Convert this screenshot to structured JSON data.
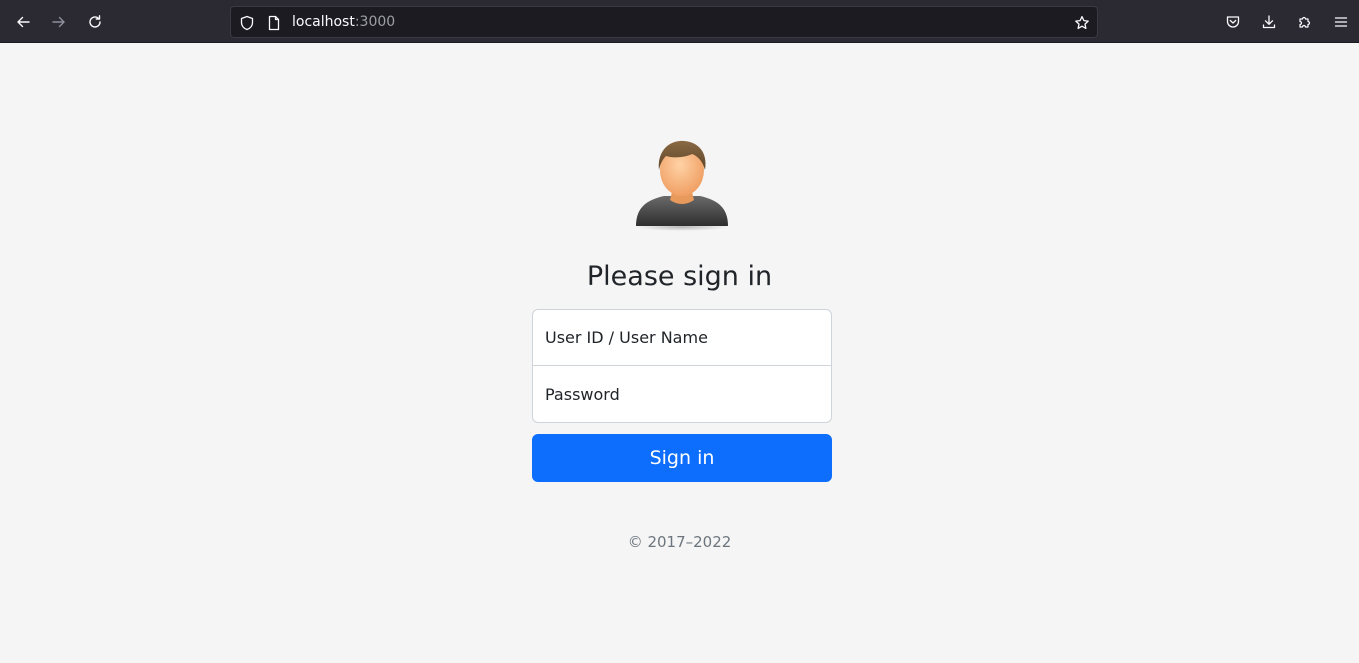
{
  "browser": {
    "url_host": "localhost",
    "url_port": ":3000",
    "icons": {
      "back": "arrow-left-icon",
      "forward": "arrow-right-icon",
      "reload": "reload-icon",
      "shield": "shield-icon",
      "page": "page-icon",
      "bookmark": "star-icon",
      "pocket": "pocket-icon",
      "downloads": "download-icon",
      "extensions": "puzzle-icon",
      "menu": "hamburger-menu-icon"
    }
  },
  "login": {
    "avatar_icon": "user-avatar-icon",
    "title": "Please sign in",
    "username_placeholder": "User ID / User Name",
    "username_value": "",
    "password_placeholder": "Password",
    "password_value": "",
    "submit_label": "Sign in",
    "footer": "© 2017–2022"
  },
  "colors": {
    "primary": "#0d6efd",
    "page_background": "#f5f5f5",
    "chrome_background": "#2b2a33",
    "urlbar_background": "#1c1b22"
  }
}
